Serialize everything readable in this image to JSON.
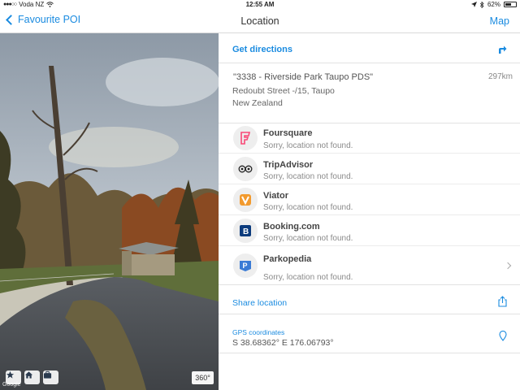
{
  "status_bar": {
    "carrier": "Voda NZ",
    "time": "12:55 AM",
    "battery": "62%",
    "battery_level": 0.62
  },
  "nav": {
    "back_label": "Favourite POI",
    "title": "Location",
    "map_label": "Map"
  },
  "streetview": {
    "badge_label": "360°",
    "buttons": [
      "star-icon",
      "home-icon",
      "briefcase-icon"
    ]
  },
  "details": {
    "directions_label": "Get directions",
    "place_name": "\"3338 - Riverside Park Taupo PDS\"",
    "distance": "297km",
    "address_line1": "Redoubt Street -/15, Taupo",
    "address_line2": "New Zealand"
  },
  "providers": [
    {
      "name": "Foursquare",
      "status": "Sorry, location not found.",
      "icon": "foursquare-icon",
      "color": "#f94877"
    },
    {
      "name": "TripAdvisor",
      "status": "Sorry, location not found.",
      "icon": "tripadvisor-icon",
      "color": "#222222"
    },
    {
      "name": "Viator",
      "status": "Sorry, location not found.",
      "icon": "viator-icon",
      "color": "#f29a2e"
    },
    {
      "name": "Booking.com",
      "status": "Sorry, location not found.",
      "icon": "booking-icon",
      "color": "#0c3b7c"
    },
    {
      "name": "Parkopedia",
      "status": "Sorry, location not found.",
      "icon": "parkopedia-icon",
      "color": "#3a7bd5"
    }
  ],
  "share": {
    "label": "Share location"
  },
  "gps": {
    "label": "GPS coordinates",
    "value": "S 38.68362° E 176.06793°"
  },
  "colors": {
    "accent": "#1a8be0"
  }
}
